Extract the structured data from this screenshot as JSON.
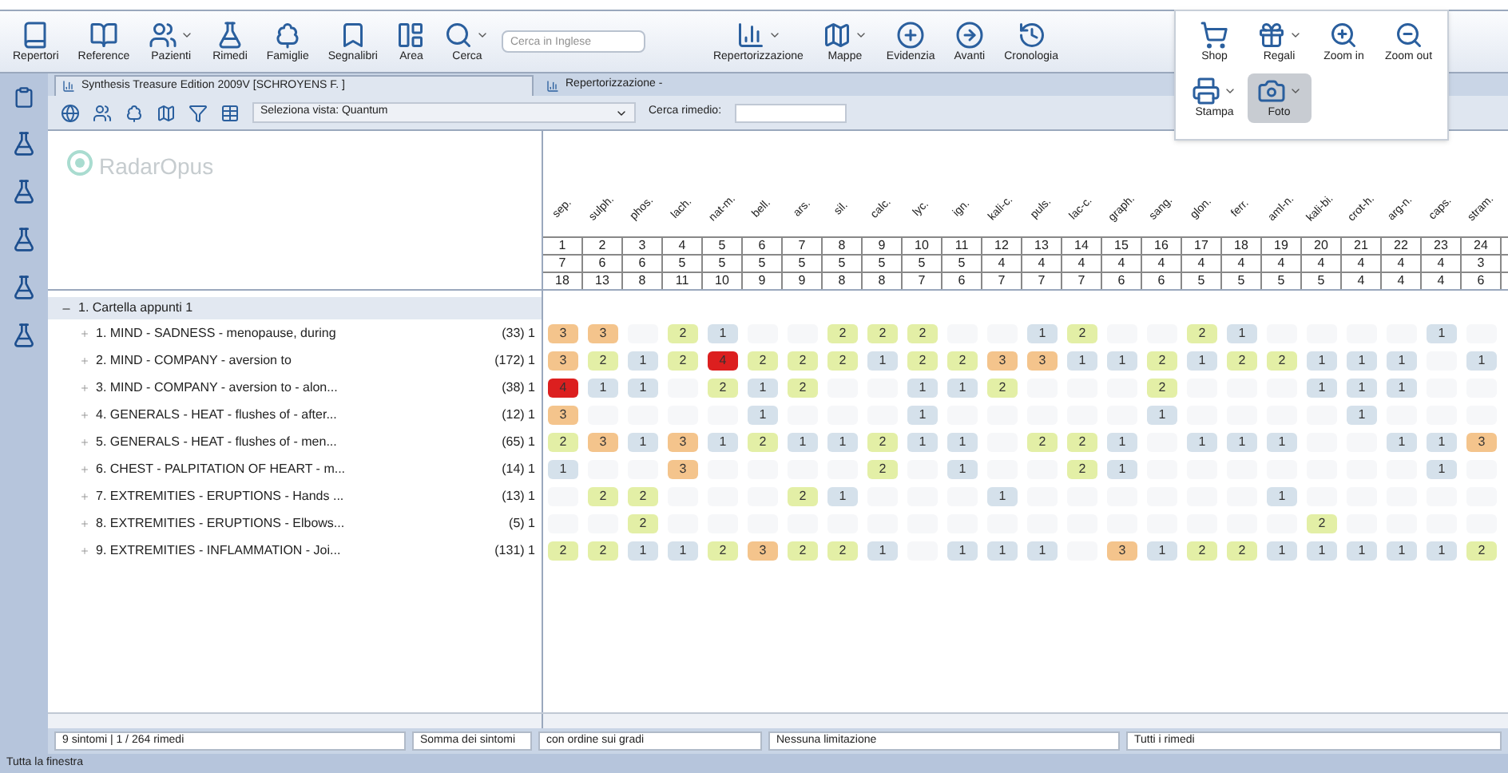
{
  "toolbar": {
    "buttons": [
      {
        "label": "Repertori",
        "dropdown": false
      },
      {
        "label": "Reference",
        "dropdown": false
      },
      {
        "label": "Pazienti",
        "dropdown": true
      },
      {
        "label": "Rimedi",
        "dropdown": false
      },
      {
        "label": "Famiglie",
        "dropdown": false
      },
      {
        "label": "Segnalibri",
        "dropdown": false
      },
      {
        "label": "Area",
        "dropdown": false
      },
      {
        "label": "Cerca",
        "dropdown": true
      }
    ],
    "search": {
      "placeholder": "Cerca in Inglese"
    },
    "buttons_right": [
      {
        "label": "Repertorizzazione",
        "dropdown": true
      },
      {
        "label": "Mappe",
        "dropdown": true
      },
      {
        "label": "Evidenzia",
        "dropdown": false
      },
      {
        "label": "Avanti",
        "dropdown": false
      },
      {
        "label": "Cronologia",
        "dropdown": false
      }
    ]
  },
  "popup": {
    "buttons": [
      {
        "label": "Shop",
        "dropdown": false,
        "pressed": false
      },
      {
        "label": "Regali",
        "dropdown": true,
        "pressed": false
      },
      {
        "label": "Zoom in",
        "dropdown": false,
        "pressed": false
      },
      {
        "label": "Zoom out",
        "dropdown": false,
        "pressed": false
      },
      {
        "label": "Stampa",
        "dropdown": true,
        "pressed": false
      },
      {
        "label": "Foto",
        "dropdown": true,
        "pressed": true
      }
    ]
  },
  "tabs": [
    {
      "label": "Synthesis Treasure Edition 2009V [SCHROYENS F. ]",
      "selected": true
    },
    {
      "label": "Repertorizzazione -",
      "selected": false
    }
  ],
  "view_bar": {
    "view_select": "Seleziona vista: Quantum",
    "remedy_search_label": "Cerca rimedio:"
  },
  "logo": "RadarOpus",
  "tree": {
    "folder": {
      "label": "1. Cartella appunti 1",
      "expanded": true
    },
    "rows": [
      {
        "label": "1. MIND - SADNESS - menopause, during",
        "count": "(33) 1"
      },
      {
        "label": "2. MIND - COMPANY - aversion to",
        "count": "(172) 1"
      },
      {
        "label": "3. MIND - COMPANY - aversion to - alon...",
        "count": "(38) 1"
      },
      {
        "label": "4. GENERALS - HEAT - flushes of - after...",
        "count": "(12) 1"
      },
      {
        "label": "5. GENERALS - HEAT - flushes of - men...",
        "count": "(65) 1"
      },
      {
        "label": "6. CHEST - PALPITATION OF HEART - m...",
        "count": "(14) 1"
      },
      {
        "label": "7. EXTREMITIES - ERUPTIONS - Hands ...",
        "count": "(13) 1"
      },
      {
        "label": "8. EXTREMITIES - ERUPTIONS - Elbows...",
        "count": "(5) 1"
      },
      {
        "label": "9. EXTREMITIES - INFLAMMATION - Joi...",
        "count": "(131) 1"
      }
    ]
  },
  "grid": {
    "remedies": [
      "sep.",
      "sulph.",
      "phos.",
      "lach.",
      "nat-m.",
      "bell.",
      "ars.",
      "sil.",
      "calc.",
      "lyc.",
      "ign.",
      "kali-c.",
      "puls.",
      "lac-c.",
      "graph.",
      "sang.",
      "glon.",
      "ferr.",
      "aml-n.",
      "kali-bi.",
      "crot-h.",
      "arg-n.",
      "caps.",
      "stram."
    ],
    "numbers": [
      "1",
      "2",
      "3",
      "4",
      "5",
      "6",
      "7",
      "8",
      "9",
      "10",
      "11",
      "12",
      "13",
      "14",
      "15",
      "16",
      "17",
      "18",
      "19",
      "20",
      "21",
      "22",
      "23",
      "24"
    ],
    "counts": [
      "7",
      "6",
      "6",
      "5",
      "5",
      "5",
      "5",
      "5",
      "5",
      "5",
      "5",
      "4",
      "4",
      "4",
      "4",
      "4",
      "4",
      "4",
      "4",
      "4",
      "4",
      "4",
      "4",
      "3"
    ],
    "sums": [
      "18",
      "13",
      "8",
      "11",
      "10",
      "9",
      "9",
      "8",
      "8",
      "7",
      "6",
      "7",
      "7",
      "7",
      "6",
      "6",
      "5",
      "5",
      "5",
      "5",
      "4",
      "4",
      "4",
      "6"
    ],
    "rows": [
      [
        {
          "text": "3",
          "color": "#f4c48c"
        },
        {
          "text": "3",
          "color": "#f4c48c"
        },
        null,
        {
          "text": "2",
          "color": "#e3efa6"
        },
        {
          "text": "1",
          "color": "#d5e1eb"
        },
        null,
        null,
        {
          "text": "2",
          "color": "#e3efa6"
        },
        {
          "text": "2",
          "color": "#e3efa6"
        },
        {
          "text": "2",
          "color": "#e3efa6"
        },
        null,
        null,
        {
          "text": "1",
          "color": "#d5e1eb"
        },
        {
          "text": "2",
          "color": "#e3efa6"
        },
        null,
        null,
        {
          "text": "2",
          "color": "#e3efa6"
        },
        {
          "text": "1",
          "color": "#d5e1eb"
        },
        null,
        null,
        null,
        null,
        {
          "text": "1",
          "color": "#d5e1eb"
        },
        null
      ],
      [
        {
          "text": "3",
          "color": "#f4c48c"
        },
        {
          "text": "2",
          "color": "#e3efa6"
        },
        {
          "text": "1",
          "color": "#d5e1eb"
        },
        {
          "text": "2",
          "color": "#e3efa6"
        },
        {
          "text": "4",
          "color": "#dc1f1f"
        },
        {
          "text": "2",
          "color": "#e3efa6"
        },
        {
          "text": "2",
          "color": "#e3efa6"
        },
        {
          "text": "2",
          "color": "#e3efa6"
        },
        {
          "text": "1",
          "color": "#d5e1eb"
        },
        {
          "text": "2",
          "color": "#e3efa6"
        },
        {
          "text": "2",
          "color": "#e3efa6"
        },
        {
          "text": "3",
          "color": "#f4c48c"
        },
        {
          "text": "3",
          "color": "#f4c48c"
        },
        {
          "text": "1",
          "color": "#d5e1eb"
        },
        {
          "text": "1",
          "color": "#d5e1eb"
        },
        {
          "text": "2",
          "color": "#e3efa6"
        },
        {
          "text": "1",
          "color": "#d5e1eb"
        },
        {
          "text": "2",
          "color": "#e3efa6"
        },
        {
          "text": "2",
          "color": "#e3efa6"
        },
        {
          "text": "1",
          "color": "#d5e1eb"
        },
        {
          "text": "1",
          "color": "#d5e1eb"
        },
        {
          "text": "1",
          "color": "#d5e1eb"
        },
        null,
        {
          "text": "1",
          "color": "#d5e1eb"
        }
      ],
      [
        {
          "text": "4",
          "color": "#dc1f1f"
        },
        {
          "text": "1",
          "color": "#d5e1eb"
        },
        {
          "text": "1",
          "color": "#d5e1eb"
        },
        null,
        {
          "text": "2",
          "color": "#e3efa6"
        },
        {
          "text": "1",
          "color": "#d5e1eb"
        },
        {
          "text": "2",
          "color": "#e3efa6"
        },
        null,
        null,
        {
          "text": "1",
          "color": "#d5e1eb"
        },
        {
          "text": "1",
          "color": "#d5e1eb"
        },
        {
          "text": "2",
          "color": "#e3efa6"
        },
        null,
        null,
        null,
        {
          "text": "2",
          "color": "#e3efa6"
        },
        null,
        null,
        null,
        {
          "text": "1",
          "color": "#d5e1eb"
        },
        {
          "text": "1",
          "color": "#d5e1eb"
        },
        {
          "text": "1",
          "color": "#d5e1eb"
        },
        null,
        null
      ],
      [
        {
          "text": "3",
          "color": "#f4c48c"
        },
        null,
        null,
        null,
        null,
        {
          "text": "1",
          "color": "#d5e1eb"
        },
        null,
        null,
        null,
        {
          "text": "1",
          "color": "#d5e1eb"
        },
        null,
        null,
        null,
        null,
        null,
        {
          "text": "1",
          "color": "#d5e1eb"
        },
        null,
        null,
        null,
        null,
        {
          "text": "1",
          "color": "#d5e1eb"
        },
        null,
        null,
        null
      ],
      [
        {
          "text": "2",
          "color": "#e3efa6"
        },
        {
          "text": "3",
          "color": "#f4c48c"
        },
        {
          "text": "1",
          "color": "#d5e1eb"
        },
        {
          "text": "3",
          "color": "#f4c48c"
        },
        {
          "text": "1",
          "color": "#d5e1eb"
        },
        {
          "text": "2",
          "color": "#e3efa6"
        },
        {
          "text": "1",
          "color": "#d5e1eb"
        },
        {
          "text": "1",
          "color": "#d5e1eb"
        },
        {
          "text": "2",
          "color": "#e3efa6"
        },
        {
          "text": "1",
          "color": "#d5e1eb"
        },
        {
          "text": "1",
          "color": "#d5e1eb"
        },
        null,
        {
          "text": "2",
          "color": "#e3efa6"
        },
        {
          "text": "2",
          "color": "#e3efa6"
        },
        {
          "text": "1",
          "color": "#d5e1eb"
        },
        null,
        {
          "text": "1",
          "color": "#d5e1eb"
        },
        {
          "text": "1",
          "color": "#d5e1eb"
        },
        {
          "text": "1",
          "color": "#d5e1eb"
        },
        null,
        null,
        {
          "text": "1",
          "color": "#d5e1eb"
        },
        {
          "text": "1",
          "color": "#d5e1eb"
        },
        {
          "text": "3",
          "color": "#f4c48c"
        }
      ],
      [
        {
          "text": "1",
          "color": "#d5e1eb"
        },
        null,
        null,
        {
          "text": "3",
          "color": "#f4c48c"
        },
        null,
        null,
        null,
        null,
        {
          "text": "2",
          "color": "#e3efa6"
        },
        null,
        {
          "text": "1",
          "color": "#d5e1eb"
        },
        null,
        null,
        {
          "text": "2",
          "color": "#e3efa6"
        },
        {
          "text": "1",
          "color": "#d5e1eb"
        },
        null,
        null,
        null,
        null,
        null,
        null,
        null,
        {
          "text": "1",
          "color": "#d5e1eb"
        },
        null
      ],
      [
        null,
        {
          "text": "2",
          "color": "#e3efa6"
        },
        {
          "text": "2",
          "color": "#e3efa6"
        },
        null,
        null,
        null,
        {
          "text": "2",
          "color": "#e3efa6"
        },
        {
          "text": "1",
          "color": "#d5e1eb"
        },
        null,
        null,
        null,
        {
          "text": "1",
          "color": "#d5e1eb"
        },
        null,
        null,
        null,
        null,
        null,
        null,
        {
          "text": "1",
          "color": "#d5e1eb"
        },
        null,
        null,
        null,
        null,
        null
      ],
      [
        null,
        null,
        {
          "text": "2",
          "color": "#e3efa6"
        },
        null,
        null,
        null,
        null,
        null,
        null,
        null,
        null,
        null,
        null,
        null,
        null,
        null,
        null,
        null,
        null,
        {
          "text": "2",
          "color": "#e3efa6"
        },
        null,
        null,
        null,
        null
      ],
      [
        {
          "text": "2",
          "color": "#e3efa6"
        },
        {
          "text": "2",
          "color": "#e3efa6"
        },
        {
          "text": "1",
          "color": "#d5e1eb"
        },
        {
          "text": "1",
          "color": "#d5e1eb"
        },
        {
          "text": "2",
          "color": "#e3efa6"
        },
        {
          "text": "3",
          "color": "#f4c48c"
        },
        {
          "text": "2",
          "color": "#e3efa6"
        },
        {
          "text": "2",
          "color": "#e3efa6"
        },
        {
          "text": "1",
          "color": "#d5e1eb"
        },
        null,
        {
          "text": "1",
          "color": "#d5e1eb"
        },
        {
          "text": "1",
          "color": "#d5e1eb"
        },
        {
          "text": "1",
          "color": "#d5e1eb"
        },
        null,
        {
          "text": "3",
          "color": "#f4c48c"
        },
        {
          "text": "1",
          "color": "#d5e1eb"
        },
        {
          "text": "2",
          "color": "#e3efa6"
        },
        {
          "text": "2",
          "color": "#e3efa6"
        },
        {
          "text": "1",
          "color": "#d5e1eb"
        },
        {
          "text": "1",
          "color": "#d5e1eb"
        },
        {
          "text": "1",
          "color": "#d5e1eb"
        },
        {
          "text": "1",
          "color": "#d5e1eb"
        },
        {
          "text": "1",
          "color": "#d5e1eb"
        },
        {
          "text": "2",
          "color": "#e3efa6"
        }
      ]
    ]
  },
  "status": [
    "9 sintomi | 1 / 264 rimedi",
    "Somma dei sintomi",
    "con ordine sui gradi",
    "Nessuna limitazione",
    "Tutti i rimedi"
  ],
  "footer": "Tutta la finestra"
}
